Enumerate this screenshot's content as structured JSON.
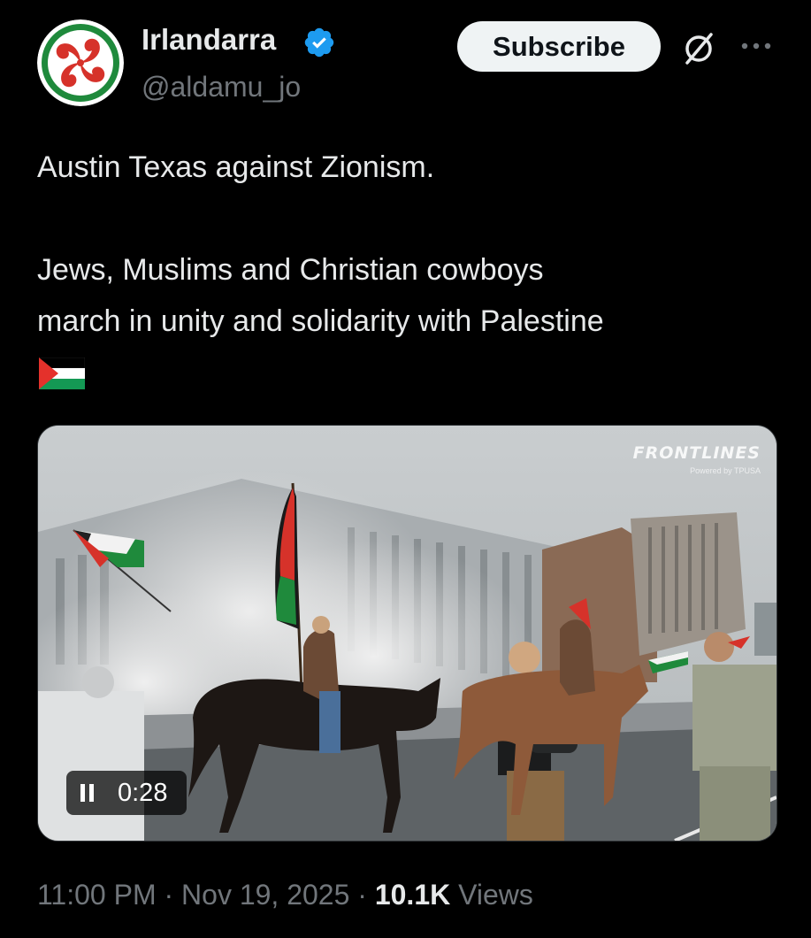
{
  "author": {
    "display_name": "Irlandarra",
    "handle": "@aldamu_jo",
    "verified": true,
    "avatar_icon": "lauburu-icon",
    "verified_icon": "verified-badge-icon"
  },
  "actions": {
    "subscribe_label": "Subscribe",
    "grok_icon": "grok-icon",
    "more_icon": "more-icon"
  },
  "tweet": {
    "lines": [
      "Austin Texas against Zionism.",
      "Jews, Muslims and Christian cowboys",
      "march in unity and solidarity with Palestine"
    ],
    "emoji": "palestine-flag-icon"
  },
  "media": {
    "watermark_title": "FRONTLINES",
    "watermark_sub": "Powered by TPUSA",
    "play_state_icon": "pause-icon",
    "duration": "0:28"
  },
  "meta": {
    "time": "11:00 PM",
    "separator": " · ",
    "date": "Nov 19, 2025",
    "views_count": "10.1K",
    "views_label": " Views"
  },
  "colors": {
    "background": "#000000",
    "text_primary": "#e7e9ea",
    "text_secondary": "#71767b",
    "verified_blue": "#1d9bf0",
    "button_bg": "#eff3f4"
  }
}
